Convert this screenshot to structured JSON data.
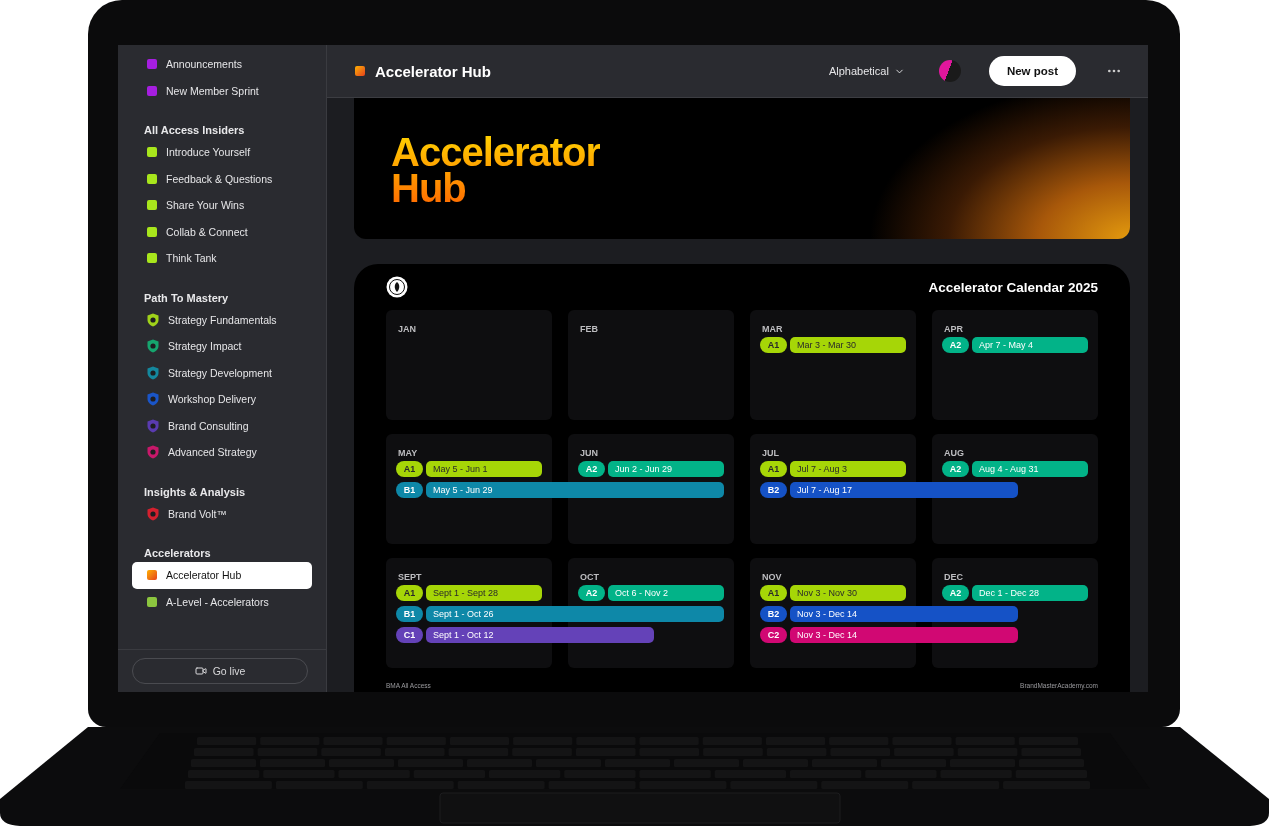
{
  "sidebar": {
    "sections": [
      {
        "items": [
          {
            "label": "Announcements",
            "kind": "square",
            "color": "#a61ee0",
            "selected": false
          },
          {
            "label": "New Member Sprint",
            "kind": "square",
            "color": "#a61ee0",
            "selected": false
          }
        ]
      },
      {
        "heading": "All Access Insiders",
        "items": [
          {
            "label": "Introduce Yourself",
            "kind": "square",
            "color": "#a8e61c",
            "selected": false
          },
          {
            "label": "Feedback & Questions",
            "kind": "square",
            "color": "#a8e61c",
            "selected": false
          },
          {
            "label": "Share Your Wins",
            "kind": "square",
            "color": "#a8e61c",
            "selected": false
          },
          {
            "label": "Collab & Connect",
            "kind": "square",
            "color": "#a8e61c",
            "selected": false
          },
          {
            "label": "Think Tank",
            "kind": "square",
            "color": "#a8e61c",
            "selected": false
          }
        ]
      },
      {
        "heading": "Path To Mastery",
        "items": [
          {
            "label": "Strategy Fundamentals",
            "kind": "shield",
            "color": "#9fd21a",
            "selected": false
          },
          {
            "label": "Strategy Impact",
            "kind": "shield",
            "color": "#16a56e",
            "selected": false
          },
          {
            "label": "Strategy Development",
            "kind": "shield",
            "color": "#14889e",
            "selected": false
          },
          {
            "label": "Workshop Delivery",
            "kind": "shield",
            "color": "#1a55c8",
            "selected": false
          },
          {
            "label": "Brand Consulting",
            "kind": "shield",
            "color": "#5a3bb0",
            "selected": false
          },
          {
            "label": "Advanced Strategy",
            "kind": "shield",
            "color": "#c8186a",
            "selected": false
          }
        ]
      },
      {
        "heading": "Insights & Analysis",
        "items": [
          {
            "label": "Brand Volt™",
            "kind": "shield",
            "color": "#d4202e",
            "selected": false
          }
        ]
      },
      {
        "heading": "Accelerators",
        "items": [
          {
            "label": "Accelerator Hub",
            "kind": "gradient",
            "color": "#f07a12",
            "selected": true
          },
          {
            "label": "A-Level - Accelerators",
            "kind": "square",
            "color": "#8cc63f",
            "selected": false
          }
        ]
      }
    ],
    "go_live": "Go live"
  },
  "header": {
    "title": "Accelerator Hub",
    "sort": "Alphabetical",
    "new_post": "New post"
  },
  "banner": {
    "title_lines": [
      "Accelerator",
      "Hub"
    ]
  },
  "calendar": {
    "title": "Accelerator Calendar 2025",
    "footer_left": "BMA All Access",
    "footer_right": "BrandMasterAcademy.com",
    "rows": [
      {
        "months": [
          {
            "label": "JAN"
          },
          {
            "label": "FEB"
          },
          {
            "label": "MAR",
            "events": [
              {
                "tag": "A1",
                "range": "Mar 3 - Mar 30",
                "color": "#a6d607",
                "kind": "single"
              }
            ]
          },
          {
            "label": "APR",
            "events": [
              {
                "tag": "A2",
                "range": "Apr 7 - May 4",
                "color": "#02b388",
                "kind": "single"
              }
            ]
          }
        ]
      },
      {
        "months": [
          {
            "label": "MAY",
            "events": [
              {
                "tag": "A1",
                "range": "May 5 - Jun 1",
                "color": "#a6d607",
                "kind": "single"
              },
              {
                "tag": "B1",
                "range": "May 5 - Jun 29",
                "color": "#0e88a8",
                "kind": "double"
              }
            ]
          },
          {
            "label": "JUN",
            "events": [
              {
                "tag": "A2",
                "range": "Jun 2 - Jun 29",
                "color": "#02b388",
                "kind": "single"
              }
            ]
          },
          {
            "label": "JUL",
            "events": [
              {
                "tag": "A1",
                "range": "Jul 7 - Aug 3",
                "color": "#a6d607",
                "kind": "single"
              },
              {
                "tag": "B2",
                "range": "Jul 7 - Aug 17",
                "color": "#1552c6",
                "kind": "partial"
              }
            ]
          },
          {
            "label": "AUG",
            "events": [
              {
                "tag": "A2",
                "range": "Aug 4 - Aug 31",
                "color": "#02b388",
                "kind": "single"
              }
            ]
          }
        ]
      },
      {
        "months": [
          {
            "label": "SEPT",
            "events": [
              {
                "tag": "A1",
                "range": "Sept 1 - Sept 28",
                "color": "#a6d607",
                "kind": "single"
              },
              {
                "tag": "B1",
                "range": "Sept 1 - Oct 26",
                "color": "#0e88a8",
                "kind": "double"
              },
              {
                "tag": "C1",
                "range": "Sept 1 - Oct 12",
                "color": "#6442b8",
                "kind": "partial"
              }
            ]
          },
          {
            "label": "OCT",
            "events": [
              {
                "tag": "A2",
                "range": "Oct 6 - Nov 2",
                "color": "#02b388",
                "kind": "single"
              }
            ]
          },
          {
            "label": "NOV",
            "events": [
              {
                "tag": "A1",
                "range": "Nov 3 - Nov 30",
                "color": "#a6d607",
                "kind": "single"
              },
              {
                "tag": "B2",
                "range": "Nov 3 - Dec 14",
                "color": "#1552c6",
                "kind": "partial"
              },
              {
                "tag": "C2",
                "range": "Nov 3 - Dec 14",
                "color": "#d10873",
                "kind": "partial"
              }
            ]
          },
          {
            "label": "DEC",
            "events": [
              {
                "tag": "A2",
                "range": "Dec 1 - Dec 28",
                "color": "#02b388",
                "kind": "single"
              }
            ]
          }
        ]
      }
    ]
  }
}
